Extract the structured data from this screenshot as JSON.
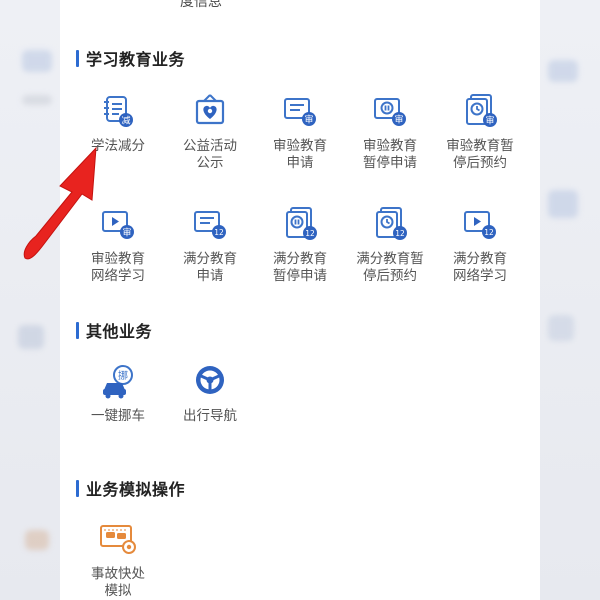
{
  "top_cutoff_text": "度信息",
  "sections": {
    "education": {
      "title": "学习教育业务",
      "items": [
        {
          "line1": "学法减分",
          "line2": ""
        },
        {
          "line1": "公益活动",
          "line2": "公示"
        },
        {
          "line1": "审验教育",
          "line2": "申请"
        },
        {
          "line1": "审验教育",
          "line2": "暂停申请"
        },
        {
          "line1": "审验教育暂",
          "line2": "停后预约"
        },
        {
          "line1": "审验教育",
          "line2": "网络学习"
        },
        {
          "line1": "满分教育",
          "line2": "申请"
        },
        {
          "line1": "满分教育",
          "line2": "暂停申请"
        },
        {
          "line1": "满分教育暂",
          "line2": "停后预约"
        },
        {
          "line1": "满分教育",
          "line2": "网络学习"
        }
      ]
    },
    "other": {
      "title": "其他业务",
      "items": [
        {
          "line1": "一键挪车"
        },
        {
          "line1": "出行导航"
        }
      ]
    },
    "simulation": {
      "title": "业务模拟操作",
      "items": [
        {
          "line1": "事故快处",
          "line2": "模拟"
        }
      ]
    }
  },
  "badges": {
    "jian": "减",
    "shen": "审",
    "twelve": "12",
    "nuo": "挪"
  },
  "colors": {
    "accent": "#2c6bd1",
    "icon_blue": "#3d74c9",
    "badge_blue": "#2f63c0",
    "arrow_red": "#e8231f",
    "orange": "#e58a3c"
  }
}
